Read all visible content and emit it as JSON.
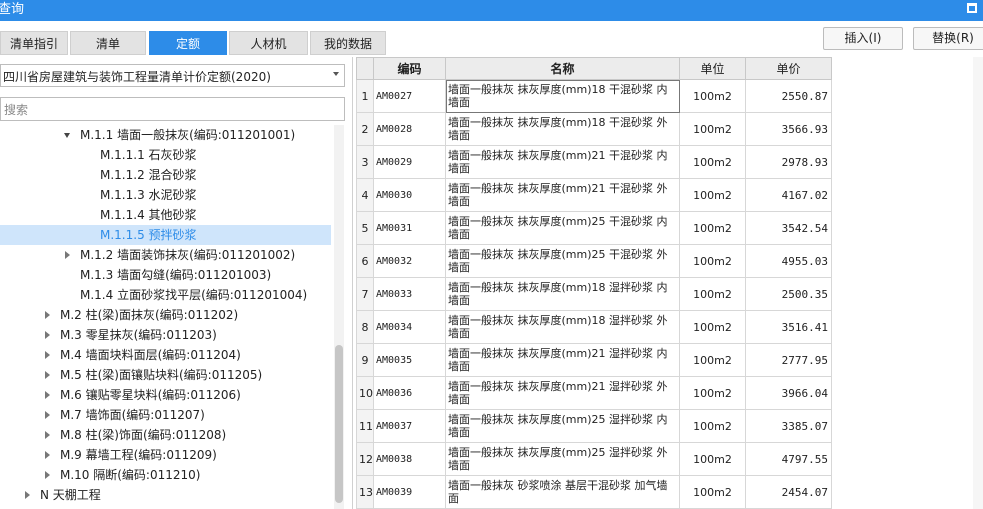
{
  "window": {
    "title": "查询"
  },
  "tabs": [
    {
      "label": "清单指引",
      "active": false
    },
    {
      "label": "清单",
      "active": false
    },
    {
      "label": "定额",
      "active": true
    },
    {
      "label": "人材机",
      "active": false
    },
    {
      "label": "我的数据",
      "active": false
    }
  ],
  "buttons": {
    "insert": "插入(I)",
    "replace": "替换(R)"
  },
  "library": {
    "selected": "四川省房屋建筑与装饰工程量清单计价定额(2020)"
  },
  "search": {
    "placeholder": "搜索",
    "value": ""
  },
  "tree": [
    {
      "label": "M.1.1 墙面一般抹灰(编码:011201001)",
      "toggle": "expanded",
      "level": 2,
      "selected": false
    },
    {
      "label": "M.1.1.1 石灰砂浆",
      "toggle": "none",
      "level": 3,
      "selected": false
    },
    {
      "label": "M.1.1.2 混合砂浆",
      "toggle": "none",
      "level": 3,
      "selected": false
    },
    {
      "label": "M.1.1.3 水泥砂浆",
      "toggle": "none",
      "level": 3,
      "selected": false
    },
    {
      "label": "M.1.1.4 其他砂浆",
      "toggle": "none",
      "level": 3,
      "selected": false
    },
    {
      "label": "M.1.1.5 预拌砂浆",
      "toggle": "none",
      "level": 3,
      "selected": true
    },
    {
      "label": "M.1.2 墙面装饰抹灰(编码:011201002)",
      "toggle": "collapsed",
      "level": 2,
      "selected": false
    },
    {
      "label": "M.1.3 墙面勾缝(编码:011201003)",
      "toggle": "none",
      "level": 2,
      "selected": false
    },
    {
      "label": "M.1.4 立面砂浆找平层(编码:011201004)",
      "toggle": "none",
      "level": 2,
      "selected": false
    },
    {
      "label": "M.2 柱(梁)面抹灰(编码:011202)",
      "toggle": "collapsed",
      "level": 1,
      "selected": false
    },
    {
      "label": "M.3 零星抹灰(编码:011203)",
      "toggle": "collapsed",
      "level": 1,
      "selected": false
    },
    {
      "label": "M.4 墙面块料面层(编码:011204)",
      "toggle": "collapsed",
      "level": 1,
      "selected": false
    },
    {
      "label": "M.5 柱(梁)面镶贴块料(编码:011205)",
      "toggle": "collapsed",
      "level": 1,
      "selected": false
    },
    {
      "label": "M.6 镶贴零星块料(编码:011206)",
      "toggle": "collapsed",
      "level": 1,
      "selected": false
    },
    {
      "label": "M.7 墙饰面(编码:011207)",
      "toggle": "collapsed",
      "level": 1,
      "selected": false
    },
    {
      "label": "M.8 柱(梁)饰面(编码:011208)",
      "toggle": "collapsed",
      "level": 1,
      "selected": false
    },
    {
      "label": "M.9 幕墙工程(编码:011209)",
      "toggle": "collapsed",
      "level": 1,
      "selected": false
    },
    {
      "label": "M.10 隔断(编码:011210)",
      "toggle": "collapsed",
      "level": 1,
      "selected": false
    },
    {
      "label": "N 天棚工程",
      "toggle": "collapsed",
      "level": 0,
      "selected": false
    }
  ],
  "table": {
    "headers": [
      "",
      "编码",
      "名称",
      "单位",
      "单价"
    ],
    "rows": [
      {
        "idx": "1",
        "code": "AM0027",
        "name": "墙面一般抹灰 抹灰厚度(mm)18 干混砂浆 内墙面",
        "unit": "100m2",
        "price": "2550.87"
      },
      {
        "idx": "2",
        "code": "AM0028",
        "name": "墙面一般抹灰 抹灰厚度(mm)18 干混砂浆 外墙面",
        "unit": "100m2",
        "price": "3566.93"
      },
      {
        "idx": "3",
        "code": "AM0029",
        "name": "墙面一般抹灰 抹灰厚度(mm)21 干混砂浆 内墙面",
        "unit": "100m2",
        "price": "2978.93"
      },
      {
        "idx": "4",
        "code": "AM0030",
        "name": "墙面一般抹灰 抹灰厚度(mm)21 干混砂浆 外墙面",
        "unit": "100m2",
        "price": "4167.02"
      },
      {
        "idx": "5",
        "code": "AM0031",
        "name": "墙面一般抹灰 抹灰厚度(mm)25 干混砂浆 内墙面",
        "unit": "100m2",
        "price": "3542.54"
      },
      {
        "idx": "6",
        "code": "AM0032",
        "name": "墙面一般抹灰 抹灰厚度(mm)25 干混砂浆 外墙面",
        "unit": "100m2",
        "price": "4955.03"
      },
      {
        "idx": "7",
        "code": "AM0033",
        "name": "墙面一般抹灰 抹灰厚度(mm)18 湿拌砂浆 内墙面",
        "unit": "100m2",
        "price": "2500.35"
      },
      {
        "idx": "8",
        "code": "AM0034",
        "name": "墙面一般抹灰 抹灰厚度(mm)18 湿拌砂浆 外墙面",
        "unit": "100m2",
        "price": "3516.41"
      },
      {
        "idx": "9",
        "code": "AM0035",
        "name": "墙面一般抹灰 抹灰厚度(mm)21 湿拌砂浆 内墙面",
        "unit": "100m2",
        "price": "2777.95"
      },
      {
        "idx": "10",
        "code": "AM0036",
        "name": "墙面一般抹灰 抹灰厚度(mm)21 湿拌砂浆 外墙面",
        "unit": "100m2",
        "price": "3966.04"
      },
      {
        "idx": "11",
        "code": "AM0037",
        "name": "墙面一般抹灰 抹灰厚度(mm)25 湿拌砂浆 内墙面",
        "unit": "100m2",
        "price": "3385.07"
      },
      {
        "idx": "12",
        "code": "AM0038",
        "name": "墙面一般抹灰 抹灰厚度(mm)25 湿拌砂浆 外墙面",
        "unit": "100m2",
        "price": "4797.55"
      },
      {
        "idx": "13",
        "code": "AM0039",
        "name": "墙面一般抹灰 砂浆喷涂 基层干混砂浆 加气墙面",
        "unit": "100m2",
        "price": "2454.07"
      }
    ]
  },
  "colors": {
    "accent": "#2d8ce8",
    "selected_row": "#cfe5fb"
  }
}
